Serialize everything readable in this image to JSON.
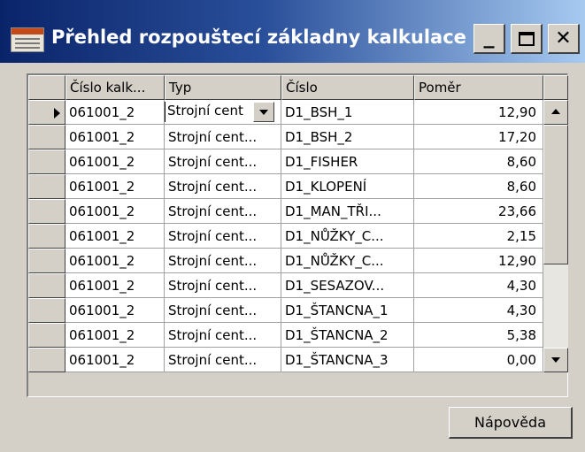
{
  "window": {
    "title": "Přehled rozpouštecí základny kalkulace",
    "controls": {
      "minimize": "_",
      "close": "✕"
    }
  },
  "grid": {
    "columns": [
      "Číslo kalk...",
      "Typ",
      "Číslo",
      "Poměr"
    ],
    "current_row": 0,
    "editor_value": "Strojní cent",
    "rows": [
      [
        "061001_2",
        "Strojní cent...",
        "D1_BSH_1",
        "12,90"
      ],
      [
        "061001_2",
        "Strojní cent...",
        "D1_BSH_2",
        "17,20"
      ],
      [
        "061001_2",
        "Strojní cent...",
        "D1_FISHER",
        "8,60"
      ],
      [
        "061001_2",
        "Strojní cent...",
        "D1_KLOPENÍ",
        "8,60"
      ],
      [
        "061001_2",
        "Strojní cent...",
        "D1_MAN_TŘI...",
        "23,66"
      ],
      [
        "061001_2",
        "Strojní cent...",
        "D1_NŮŽKY_C...",
        "2,15"
      ],
      [
        "061001_2",
        "Strojní cent...",
        "D1_NŮŽKY_C...",
        "12,90"
      ],
      [
        "061001_2",
        "Strojní cent...",
        "D1_SESAZOV...",
        "4,30"
      ],
      [
        "061001_2",
        "Strojní cent...",
        "D1_ŠTANCNA_1",
        "4,30"
      ],
      [
        "061001_2",
        "Strojní cent...",
        "D1_ŠTANCNA_2",
        "5,38"
      ],
      [
        "061001_2",
        "Strojní cent...",
        "D1_ŠTANCNA_3",
        "0,00"
      ]
    ]
  },
  "footer": {
    "help_label": "Nápověda"
  }
}
